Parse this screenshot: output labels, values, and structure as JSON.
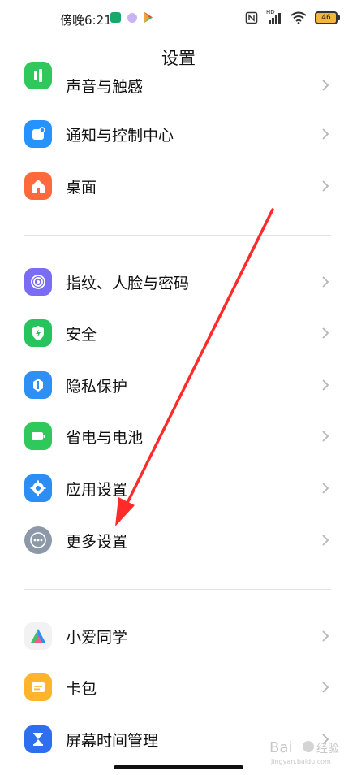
{
  "status": {
    "time": "傍晚6:21",
    "battery": "46",
    "network_label": "HD"
  },
  "title": "设置",
  "section1": [
    {
      "id": "sound",
      "label": "声音与触感",
      "icon": "sound-icon",
      "color": "#2fc85a"
    },
    {
      "id": "notify",
      "label": "通知与控制中心",
      "icon": "notification-icon",
      "color": "#2493ff"
    },
    {
      "id": "desktop",
      "label": "桌面",
      "icon": "home-icon",
      "color": "#ff6a3d"
    }
  ],
  "section2": [
    {
      "id": "fingerprint",
      "label": "指纹、人脸与密码",
      "icon": "fingerprint-icon",
      "color": "#7b6cf6"
    },
    {
      "id": "security",
      "label": "安全",
      "icon": "shield-icon",
      "color": "#27c45e"
    },
    {
      "id": "privacy",
      "label": "隐私保护",
      "icon": "privacy-icon",
      "color": "#2e8ff5"
    },
    {
      "id": "battery",
      "label": "省电与电池",
      "icon": "battery-icon",
      "color": "#2fc85a"
    },
    {
      "id": "apps",
      "label": "应用设置",
      "icon": "gear-icon",
      "color": "#2b8ef4"
    },
    {
      "id": "more",
      "label": "更多设置",
      "icon": "more-icon",
      "color": "#8d99a8"
    }
  ],
  "section3": [
    {
      "id": "xiaoai",
      "label": "小爱同学",
      "icon": "xiaoai-icon",
      "color": "#f2f2f2"
    },
    {
      "id": "wallet",
      "label": "卡包",
      "icon": "wallet-icon",
      "color": "#ffb52b"
    },
    {
      "id": "screentime",
      "label": "屏幕时间管理",
      "icon": "hourglass-icon",
      "color": "#2e6ff0"
    }
  ],
  "annotation_color": "#ff2a2a"
}
